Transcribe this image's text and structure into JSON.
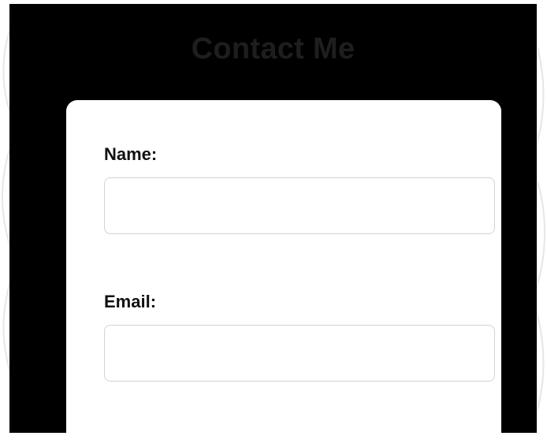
{
  "contact_form": {
    "title": "Contact Me",
    "name_label": "Name:",
    "name_value": "",
    "email_label": "Email:",
    "email_value": ""
  },
  "colors": {
    "page_background": "#ffffff",
    "panel_background": "#000000",
    "title_text": "#1e1e1e",
    "card_background": "#ffffff",
    "input_border": "#d3d3d3"
  }
}
